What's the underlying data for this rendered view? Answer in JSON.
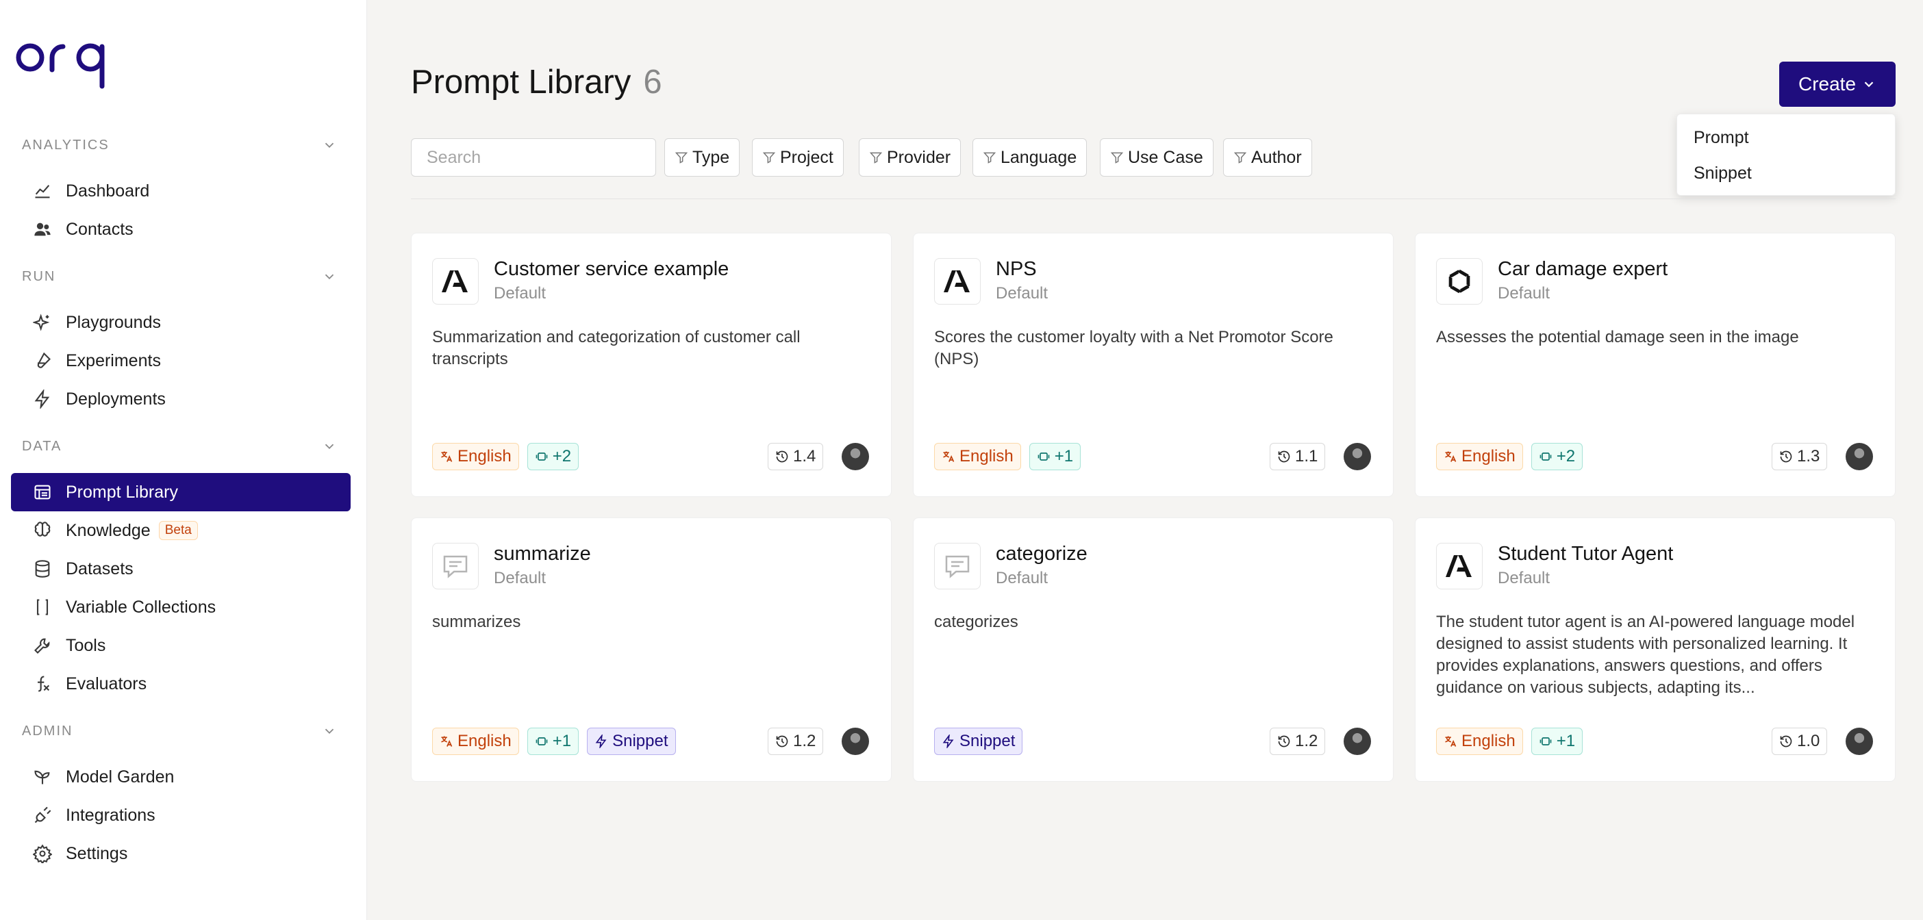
{
  "brand": {
    "logo_text": "orq",
    "accent": "#1f0d7e"
  },
  "sidebar": {
    "sections": [
      {
        "label": "ANALYTICS",
        "items": [
          {
            "label": "Dashboard",
            "icon": "chart-line-icon"
          },
          {
            "label": "Contacts",
            "icon": "users-icon"
          }
        ]
      },
      {
        "label": "RUN",
        "items": [
          {
            "label": "Playgrounds",
            "icon": "sparkles-icon"
          },
          {
            "label": "Experiments",
            "icon": "flask-icon"
          },
          {
            "label": "Deployments",
            "icon": "lightning-icon"
          }
        ]
      },
      {
        "label": "DATA",
        "items": [
          {
            "label": "Prompt Library",
            "icon": "library-icon",
            "active": true
          },
          {
            "label": "Knowledge",
            "icon": "brain-icon",
            "badge": "Beta"
          },
          {
            "label": "Datasets",
            "icon": "database-icon"
          },
          {
            "label": "Variable Collections",
            "icon": "braces-icon"
          },
          {
            "label": "Tools",
            "icon": "wrench-icon"
          },
          {
            "label": "Evaluators",
            "icon": "function-icon"
          }
        ]
      },
      {
        "label": "ADMIN",
        "items": [
          {
            "label": "Model Garden",
            "icon": "sprout-icon"
          },
          {
            "label": "Integrations",
            "icon": "plug-icon"
          },
          {
            "label": "Settings",
            "icon": "gear-icon"
          }
        ]
      }
    ]
  },
  "header": {
    "title": "Prompt Library",
    "count": "6",
    "create_label": "Create"
  },
  "create_menu": {
    "items": [
      "Prompt",
      "Snippet"
    ]
  },
  "search": {
    "placeholder": "Search"
  },
  "filters": [
    "Type",
    "Project",
    "Provider",
    "Language",
    "Use Case",
    "Author"
  ],
  "cards": [
    {
      "title": "Customer service example",
      "subtitle": "Default",
      "provider_icon": "anthropic-icon",
      "description": "Summarization and categorization of customer call transcripts",
      "language": "English",
      "models": "+2",
      "snippet": null,
      "version": "1.4"
    },
    {
      "title": "NPS",
      "subtitle": "Default",
      "provider_icon": "anthropic-icon",
      "description": "Scores the customer loyalty with a Net Promotor Score (NPS)",
      "language": "English",
      "models": "+1",
      "snippet": null,
      "version": "1.1"
    },
    {
      "title": "Car damage expert",
      "subtitle": "Default",
      "provider_icon": "openai-icon",
      "description": "Assesses the potential damage seen in the image",
      "language": "English",
      "models": "+2",
      "snippet": null,
      "version": "1.3"
    },
    {
      "title": "summarize",
      "subtitle": "Default",
      "provider_icon": "message-icon",
      "description": "summarizes",
      "language": "English",
      "models": "+1",
      "snippet": "Snippet",
      "version": "1.2"
    },
    {
      "title": "categorize",
      "subtitle": "Default",
      "provider_icon": "message-icon",
      "description": "categorizes",
      "language": null,
      "models": null,
      "snippet": "Snippet",
      "version": "1.2"
    },
    {
      "title": "Student Tutor Agent",
      "subtitle": "Default",
      "provider_icon": "anthropic-icon",
      "description": "The student tutor agent is an AI-powered language model designed to assist students with personalized learning. It provides explanations, answers questions, and offers guidance on various subjects, adapting its...",
      "language": "English",
      "models": "+1",
      "snippet": null,
      "version": "1.0"
    }
  ]
}
